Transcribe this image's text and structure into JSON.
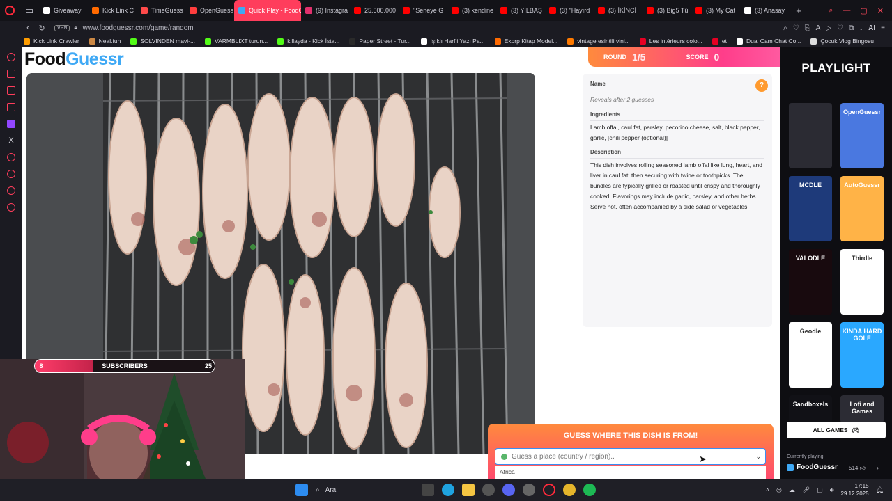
{
  "browser": {
    "tabs": [
      {
        "label": "Giveaway",
        "color": "#ffffff"
      },
      {
        "label": "Kick Link C",
        "color": "#ff6a00"
      },
      {
        "label": "TimeGuess",
        "color": "#ff4a4a"
      },
      {
        "label": "OpenGuess",
        "color": "#ff3d3d"
      },
      {
        "label": "Quick Play - FoodGu",
        "color": "#3fa9f5",
        "active": true
      },
      {
        "label": "(9) Instagra",
        "color": "#e1306c"
      },
      {
        "label": "25.500.000",
        "color": "#ff0000"
      },
      {
        "label": "\"Seneye G",
        "color": "#ff0000"
      },
      {
        "label": "(3) kendine",
        "color": "#ff0000"
      },
      {
        "label": "(3) YILBAŞ",
        "color": "#ff0000"
      },
      {
        "label": "(3) \"Hayırd",
        "color": "#ff0000"
      },
      {
        "label": "(3) İKİNCİ",
        "color": "#ff0000"
      },
      {
        "label": "(3) Big5 Tü",
        "color": "#ff0000"
      },
      {
        "label": "(3) My Cat",
        "color": "#ff0000"
      },
      {
        "label": "(3) Anasay",
        "color": "#ffffff"
      }
    ],
    "vpn_label": "VPN",
    "url": "www.foodguessr.com/game/random",
    "ai_label": "AI",
    "bookmarks": [
      {
        "label": "Kick Link Crawler",
        "color": "#ff9d00"
      },
      {
        "label": "Neal.fun",
        "color": "#cc8844"
      },
      {
        "label": "SOLVINDEN mavi-...",
        "color": "#53fc18"
      },
      {
        "label": "VARMBLIXT turun...",
        "color": "#53fc18"
      },
      {
        "label": "killayda - Kick İsta...",
        "color": "#53fc18"
      },
      {
        "label": "Paper Street - Tur...",
        "color": "#2a2a2a"
      },
      {
        "label": "Işıklı Harfli Yazı Pa...",
        "color": "#ffffff"
      },
      {
        "label": "Ekorp Kitap Model...",
        "color": "#ff6a00"
      },
      {
        "label": "vintage esintili vini...",
        "color": "#ff7a00"
      },
      {
        "label": "Les intérieurs colo...",
        "color": "#e60023"
      },
      {
        "label": "et",
        "color": "#e60023"
      },
      {
        "label": "Dual Cam Chat Co...",
        "color": "#ffffff"
      },
      {
        "label": "Çocuk Vlog Bingosu",
        "color": "#dddddd"
      }
    ]
  },
  "game": {
    "logo_food": "Food",
    "logo_guessr": "Guessr",
    "round_label": "ROUND",
    "round_value": "1/5",
    "score_label": "SCORE",
    "score_value": "0",
    "name_label": "Name",
    "name_value": "Reveals after 2 guesses",
    "ingredients_label": "Ingredients",
    "ingredients_value": "Lamb offal, caul fat, parsley, pecorino cheese, salt, black pepper, garlic, [chili pepper (optional)]",
    "description_label": "Description",
    "description_value": "This dish involves rolling seasoned lamb offal like lung, heart, and liver in caul fat, then securing with twine or toothpicks. The bundles are typically grilled or roasted until crispy and thoroughly cooked. Flavorings may include garlic, parsley, and other herbs. Serve hot, often accompanied by a side salad or vegetables.",
    "help_icon": "?",
    "guess_title": "GUESS WHERE THIS DISH IS FROM!",
    "guess_placeholder": "Guess a place (country / region)..",
    "guess_first_option": "Africa"
  },
  "playlight": {
    "logo": "PLAYLIGHT",
    "tiles": [
      {
        "label": "",
        "color": "#2b2b33"
      },
      {
        "label": "OpenGuessr",
        "color": "#4a78e0"
      },
      {
        "label": "MCDLE",
        "color": "#1e3a7a"
      },
      {
        "label": "AutoGuessr",
        "color": "#ffb347"
      },
      {
        "label": "VALODLE",
        "color": "#180a0e"
      },
      {
        "label": "Thirdle",
        "color": "#ffffff"
      },
      {
        "label": "Geodle",
        "color": "#ffffff"
      },
      {
        "label": "KINDA HARD GOLF",
        "color": "#2aa8ff"
      },
      {
        "label": "Sandboxels",
        "color": "#111116"
      },
      {
        "label": "Lofi and Games",
        "color": "#2c2c34"
      }
    ],
    "all_games_label": "ALL GAMES",
    "currently_playing_label": "Currently playing",
    "current_game": "FoodGuessr",
    "likes": "514"
  },
  "stream": {
    "subs_current": "8",
    "subs_label": "SUBSCRIBERS",
    "subs_goal": "25",
    "subs_progress": 0.32
  },
  "taskbar": {
    "search_label": "Ara",
    "time": "17:15",
    "date": "29.12.2025"
  }
}
